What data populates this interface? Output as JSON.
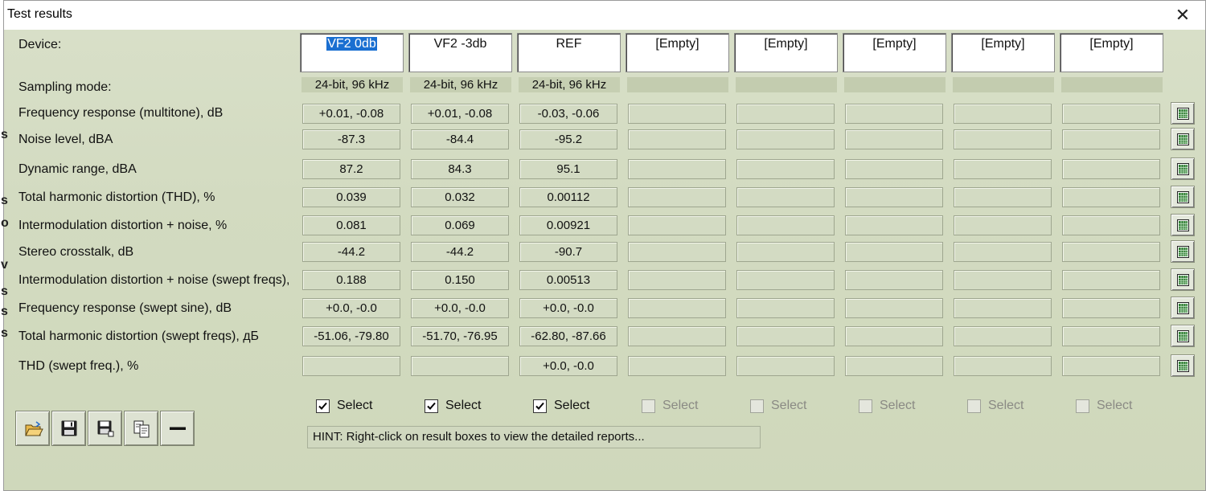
{
  "window": {
    "title": "Test results",
    "close": "✕"
  },
  "labels": {
    "device": "Device:",
    "sampling_mode": "Sampling mode:"
  },
  "devices": [
    "VF2 0db",
    "VF2 -3db",
    "REF",
    "[Empty]",
    "[Empty]",
    "[Empty]",
    "[Empty]",
    "[Empty]"
  ],
  "selected_device_index": 0,
  "sampling_modes": [
    "24-bit, 96 kHz",
    "24-bit, 96 kHz",
    "24-bit, 96 kHz",
    "",
    "",
    "",
    "",
    ""
  ],
  "rows": [
    {
      "label": "Frequency response (multitone), dB",
      "values": [
        "+0.01, -0.08",
        "+0.01, -0.08",
        "-0.03, -0.06",
        "",
        "",
        "",
        "",
        ""
      ]
    },
    {
      "label": "Noise level, dBA",
      "values": [
        "-87.3",
        "-84.4",
        "-95.2",
        "",
        "",
        "",
        "",
        ""
      ]
    },
    {
      "label": "Dynamic range, dBA",
      "values": [
        "87.2",
        "84.3",
        "95.1",
        "",
        "",
        "",
        "",
        ""
      ]
    },
    {
      "label": "Total harmonic distortion (THD), %",
      "values": [
        "0.039",
        "0.032",
        "0.00112",
        "",
        "",
        "",
        "",
        ""
      ]
    },
    {
      "label": "Intermodulation distortion + noise, %",
      "values": [
        "0.081",
        "0.069",
        "0.00921",
        "",
        "",
        "",
        "",
        ""
      ]
    },
    {
      "label": "Stereo crosstalk, dB",
      "values": [
        "-44.2",
        "-44.2",
        "-90.7",
        "",
        "",
        "",
        "",
        ""
      ]
    },
    {
      "label": "Intermodulation distortion + noise (swept freqs),",
      "values": [
        "0.188",
        "0.150",
        "0.00513",
        "",
        "",
        "",
        "",
        ""
      ]
    },
    {
      "label": "Frequency response (swept sine), dB",
      "values": [
        "+0.0, -0.0",
        "+0.0, -0.0",
        "+0.0, -0.0",
        "",
        "",
        "",
        "",
        ""
      ]
    },
    {
      "label": "Total harmonic distortion (swept freqs), дБ",
      "values": [
        "-51.06, -79.80",
        "-51.70, -76.95",
        "-62.80, -87.66",
        "",
        "",
        "",
        "",
        ""
      ]
    },
    {
      "label": "THD (swept freq.), %",
      "values": [
        "",
        "",
        "+0.0, -0.0",
        "",
        "",
        "",
        "",
        ""
      ]
    }
  ],
  "select_checkboxes": [
    {
      "label": "Select",
      "checked": true,
      "enabled": true
    },
    {
      "label": "Select",
      "checked": true,
      "enabled": true
    },
    {
      "label": "Select",
      "checked": true,
      "enabled": true
    },
    {
      "label": "Select",
      "checked": false,
      "enabled": false
    },
    {
      "label": "Select",
      "checked": false,
      "enabled": false
    },
    {
      "label": "Select",
      "checked": false,
      "enabled": false
    },
    {
      "label": "Select",
      "checked": false,
      "enabled": false
    },
    {
      "label": "Select",
      "checked": false,
      "enabled": false
    }
  ],
  "toolbar": [
    {
      "name": "open-button",
      "icon": "open-folder-icon"
    },
    {
      "name": "save-button",
      "icon": "floppy-disk-icon"
    },
    {
      "name": "save-as-button",
      "icon": "floppy-disk-plus-icon"
    },
    {
      "name": "copy-button",
      "icon": "copy-pages-icon"
    },
    {
      "name": "remove-button",
      "icon": "minus-icon"
    }
  ],
  "hint": "HINT: Right-click on result boxes to view the detailed reports...",
  "background_fragments": [
    "s",
    "s",
    "o",
    "v",
    "s",
    "s",
    "s"
  ],
  "colors": {
    "window_bg": "#d3dbc1",
    "selection": "#1a6fd1",
    "graph_icon": "#2e7d32"
  }
}
